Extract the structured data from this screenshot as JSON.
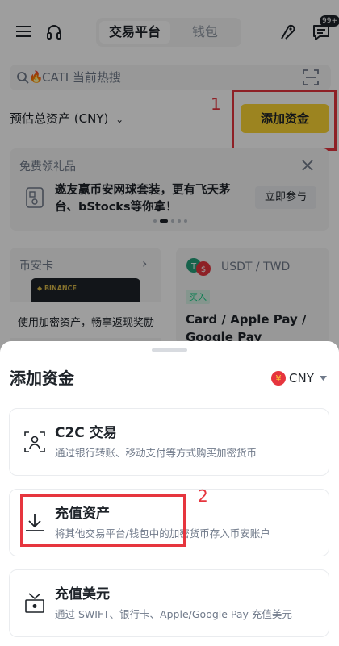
{
  "header": {
    "tabs": [
      {
        "label": "交易平台"
      },
      {
        "label": "钱包"
      }
    ],
    "notification_badge": "99+"
  },
  "search": {
    "text": "CATI 当前热搜"
  },
  "assets": {
    "estimated_label": "预估总资产 (CNY)",
    "add_funds_label": "添加资金"
  },
  "promo": {
    "title": "免费领礼品",
    "text": "邀友赢币安网球套装，更有飞天茅台、bStocks等你拿！",
    "join_label": "立即参与"
  },
  "cards": {
    "binance_card": {
      "title": "币安卡",
      "logo_text": "◆ BINANCE",
      "desc": "使用加密资产，畅享返现奖励"
    },
    "p2p": {
      "pair": "USDT / TWD",
      "tag": "买入",
      "methods": "Card / Apple Pay / Google Pay"
    }
  },
  "sheet": {
    "title": "添加资金",
    "currency": "CNY",
    "options": [
      {
        "title": "C2C 交易",
        "desc": "通过银行转账、移动支付等方式购买加密货币"
      },
      {
        "title": "充值资产",
        "desc": "将其他交易平台/钱包中的加密货币存入币安账户"
      },
      {
        "title": "充值美元",
        "desc": "通过 SWIFT、银行卡、Apple/Google Pay 充值美元"
      }
    ]
  },
  "annotations": {
    "label_1": "1",
    "label_2": "2"
  },
  "colors": {
    "brand_yellow": "#fcd535",
    "annotation_red": "#e6353e",
    "text_primary": "#1e2329",
    "text_secondary": "#707a8a"
  }
}
